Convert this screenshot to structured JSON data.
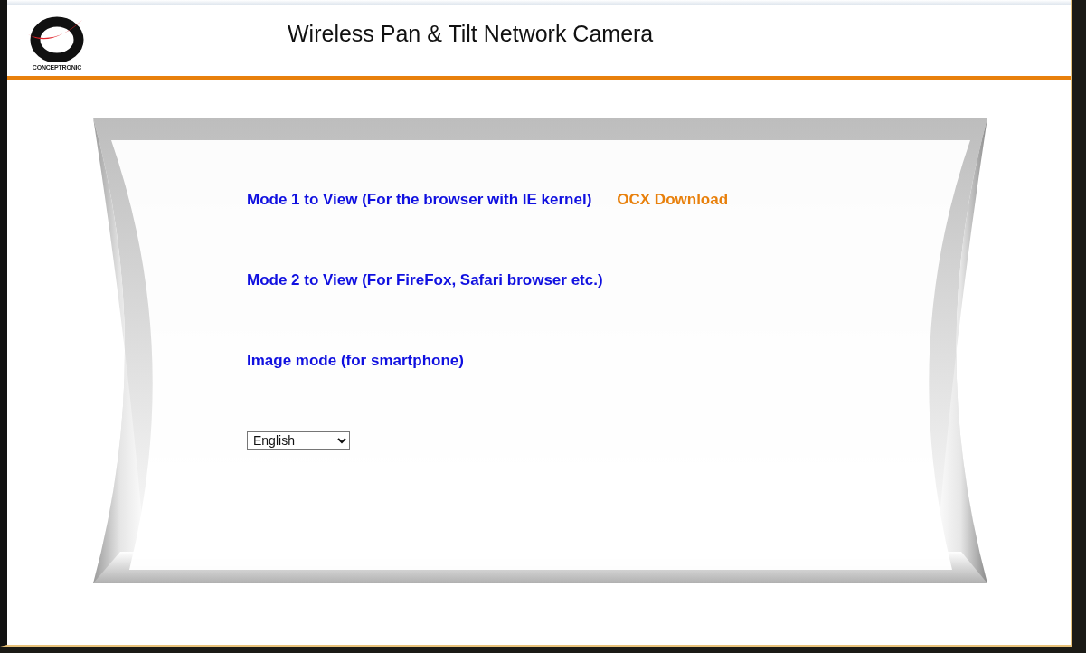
{
  "header": {
    "logo_text": "CONCEPTRONIC",
    "title": "Wireless Pan & Tilt Network Camera"
  },
  "links": [
    {
      "text": "Mode 1 to View (For the browser with IE kernel)",
      "extra": "OCX Download"
    },
    {
      "text": "Mode 2 to View (For FireFox, Safari browser etc.)"
    },
    {
      "text": "Image mode (for smartphone)"
    }
  ],
  "language": {
    "value": "English"
  }
}
